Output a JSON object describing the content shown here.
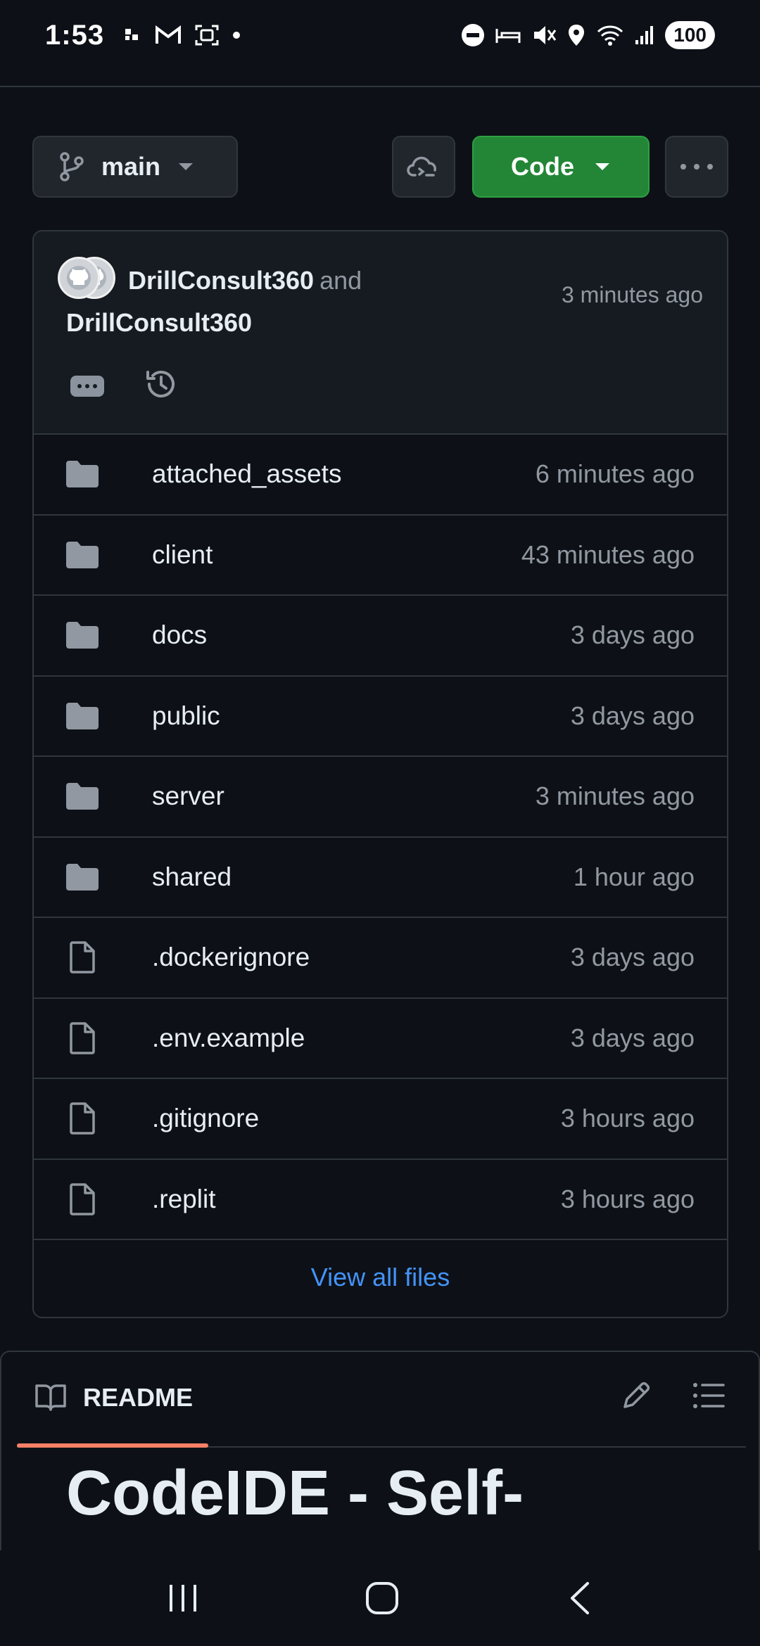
{
  "status_bar": {
    "time": "1:53",
    "battery": "100"
  },
  "toolbar": {
    "branch_label": "main",
    "code_label": "Code"
  },
  "commit": {
    "author_primary": "DrillConsult360",
    "conjunction": "and",
    "author_secondary": "DrillConsult360",
    "time": "3 minutes ago"
  },
  "files": [
    {
      "type": "folder",
      "name": "attached_assets",
      "age": "6 minutes ago"
    },
    {
      "type": "folder",
      "name": "client",
      "age": "43 minutes ago"
    },
    {
      "type": "folder",
      "name": "docs",
      "age": "3 days ago"
    },
    {
      "type": "folder",
      "name": "public",
      "age": "3 days ago"
    },
    {
      "type": "folder",
      "name": "server",
      "age": "3 minutes ago"
    },
    {
      "type": "folder",
      "name": "shared",
      "age": "1 hour ago"
    },
    {
      "type": "file",
      "name": ".dockerignore",
      "age": "3 days ago"
    },
    {
      "type": "file",
      "name": ".env.example",
      "age": "3 days ago"
    },
    {
      "type": "file",
      "name": ".gitignore",
      "age": "3 hours ago"
    },
    {
      "type": "file",
      "name": ".replit",
      "age": "3 hours ago"
    }
  ],
  "view_all_label": "View all files",
  "readme": {
    "tab_label": "README",
    "heading": "CodeIDE - Self-"
  },
  "colors": {
    "background": "#0d1117",
    "code_button": "#238636",
    "link": "#4493f8",
    "tab_underline": "#f78166"
  }
}
